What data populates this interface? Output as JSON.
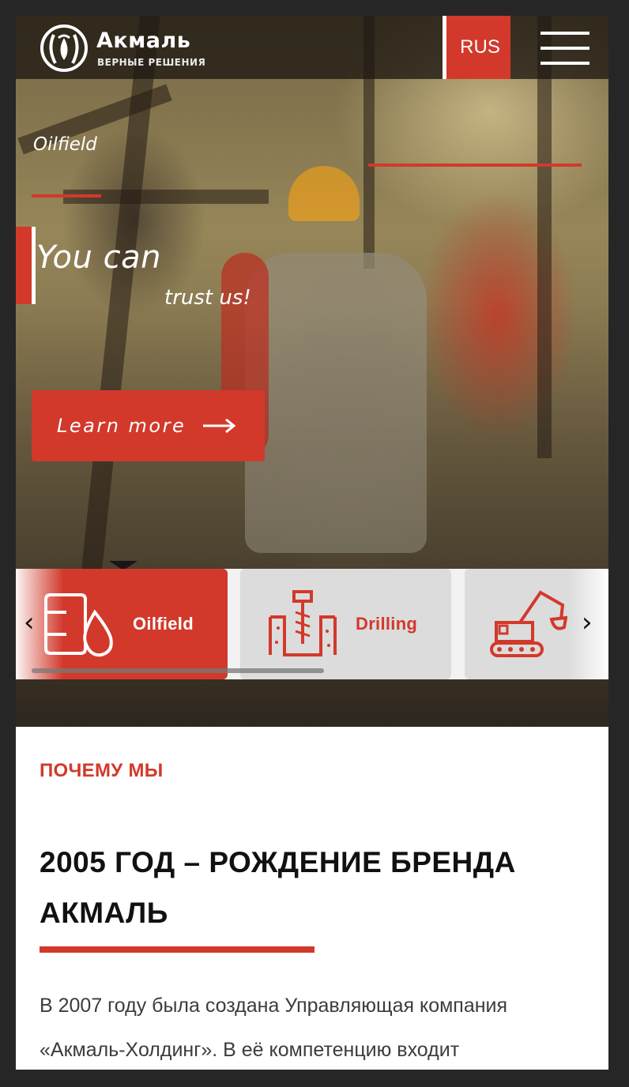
{
  "header": {
    "logo_name": "Акмаль",
    "logo_tagline": "ВЕРНЫЕ РЕШЕНИЯ",
    "language": "RUS",
    "menu_icon": "hamburger-icon"
  },
  "hero": {
    "category": "Oilfield",
    "headline_line1": "You can",
    "headline_line2": "trust us!",
    "cta_label": "Learn more",
    "cta_icon": "arrow-right-icon"
  },
  "categories": {
    "items": [
      {
        "label": "Oilfield",
        "icon": "oil-barrel-drop-icon",
        "active": true
      },
      {
        "label": "Drilling",
        "icon": "drill-bit-icon",
        "active": false
      },
      {
        "label": "",
        "icon": "excavator-icon",
        "active": false
      }
    ],
    "prev_icon": "chevron-left-icon",
    "next_icon": "chevron-right-icon"
  },
  "why_us": {
    "eyebrow": "ПОЧЕМУ МЫ",
    "title": "2005 ГОД – РОЖДЕНИЕ БРЕНДА АКМАЛЬ",
    "paragraph": "В 2007 году была создана Управляющая компания «Акмаль-Холдинг». В её компетенцию входит"
  },
  "colors": {
    "accent": "#d2392b",
    "dark_bg": "#262626",
    "card_grey": "#dcdcdc"
  }
}
